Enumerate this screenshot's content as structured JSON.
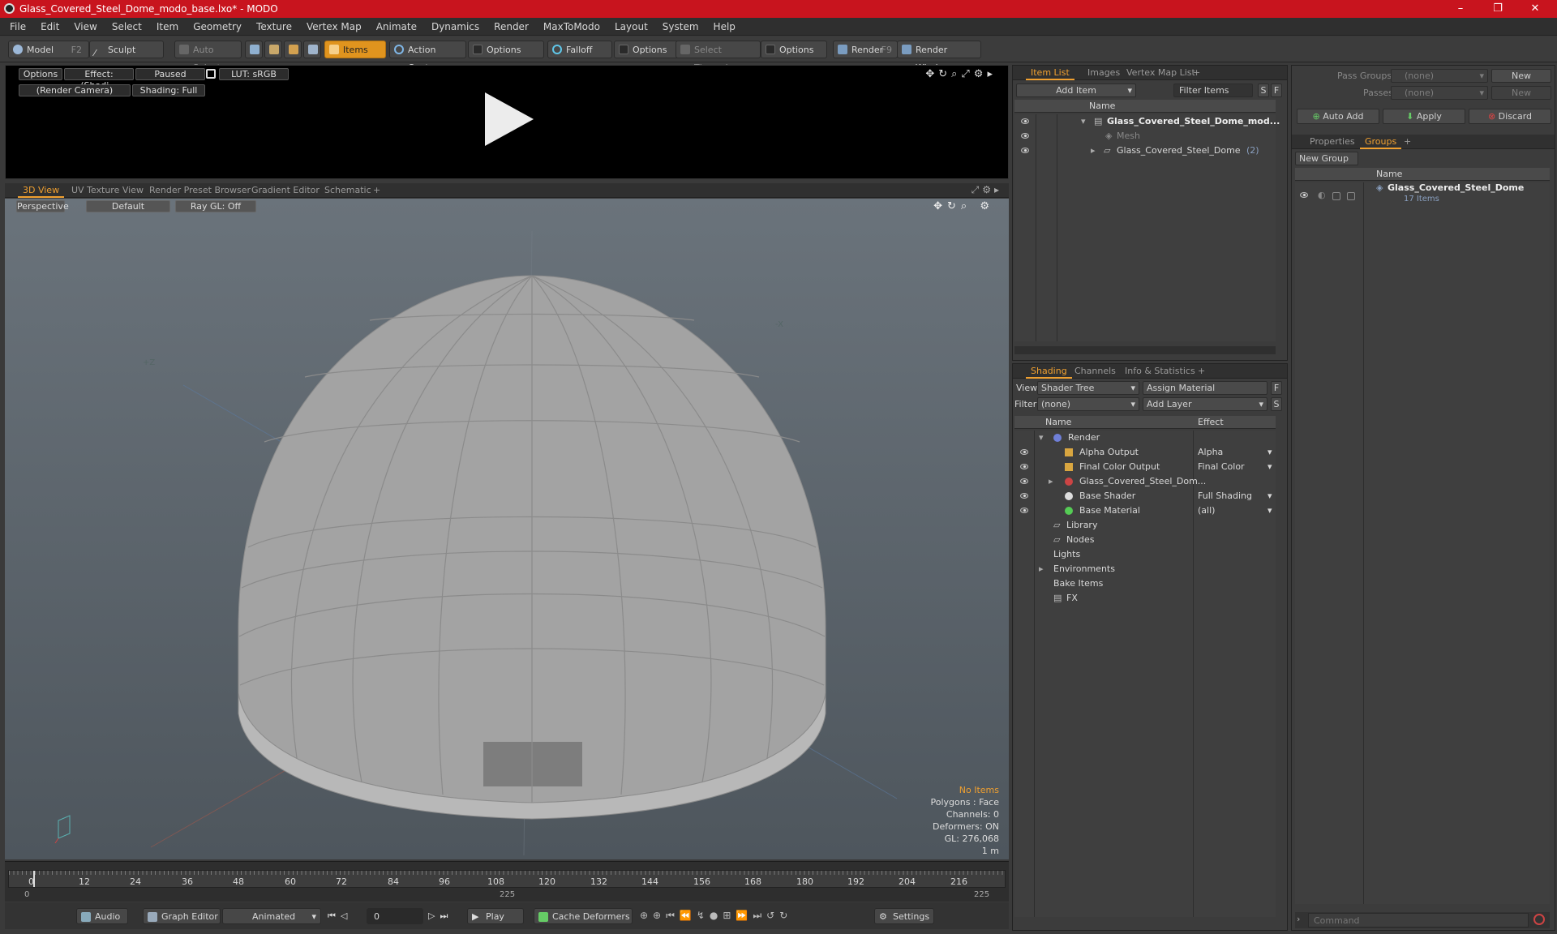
{
  "window": {
    "title": "Glass_Covered_Steel_Dome_modo_base.lxo* - MODO",
    "minimize": "–",
    "restore": "❐",
    "close": "✕"
  },
  "menu": [
    "File",
    "Edit",
    "View",
    "Select",
    "Item",
    "Geometry",
    "Texture",
    "Vertex Map",
    "Animate",
    "Dynamics",
    "Render",
    "MaxToModo",
    "Layout",
    "System",
    "Help"
  ],
  "toolbar": {
    "model": "Model",
    "model_key": "F2",
    "sculpt": "Sculpt",
    "auto_select": "Auto Select",
    "items": "Items",
    "action_center": "Action Center",
    "options1": "Options",
    "falloff": "Falloff",
    "options2": "Options",
    "select_through": "Select Through",
    "options3": "Options",
    "render": "Render",
    "render_key": "F9",
    "render_window": "Render Window"
  },
  "preview": {
    "options": "Options",
    "effect": "Effect: (Shadi...",
    "paused": "Paused",
    "lut": "LUT: sRGB",
    "camera": "(Render Camera)",
    "shading": "Shading: Full"
  },
  "viewport_tabs": [
    "3D View",
    "UV Texture View",
    "Render Preset Browser",
    "Gradient Editor",
    "Schematic",
    "+"
  ],
  "viewport": {
    "perspective": "Perspective",
    "default": "Default",
    "raygl": "Ray GL: Off",
    "axis_z": "+Z",
    "axis_x": "-X",
    "info": {
      "no_items": "No Items",
      "polygons": "Polygons : Face",
      "channels": "Channels: 0",
      "deformers": "Deformers: ON",
      "gl": "GL: 276,068",
      "unit": "1 m"
    }
  },
  "timeline": {
    "ticks": [
      "0",
      "12",
      "24",
      "36",
      "48",
      "60",
      "72",
      "84",
      "96",
      "108",
      "120",
      "132",
      "144",
      "156",
      "168",
      "180",
      "192",
      "204",
      "216"
    ],
    "start": "0",
    "mid": "225",
    "end": "225"
  },
  "bottom": {
    "audio": "Audio",
    "graph_editor": "Graph Editor",
    "animated": "Animated",
    "frame": "0",
    "play": "Play",
    "cache": "Cache Deformers",
    "settings": "Settings"
  },
  "item_list": {
    "tabs": [
      "Item List",
      "Images",
      "Vertex Map List",
      "+"
    ],
    "add_item": "Add Item",
    "filter": "Filter Items",
    "s": "S",
    "f": "F",
    "col_name": "Name",
    "rows": [
      {
        "label": "Glass_Covered_Steel_Dome_mod...",
        "count": ""
      },
      {
        "label": "Mesh",
        "count": ""
      },
      {
        "label": "Glass_Covered_Steel_Dome",
        "count": "(2)"
      }
    ]
  },
  "shading": {
    "tabs": [
      "Shading",
      "Channels",
      "Info & Statistics",
      "+"
    ],
    "view_label": "View",
    "view_value": "Shader Tree",
    "assign": "Assign Material",
    "f": "F",
    "filter_label": "Filter",
    "filter_value": "(none)",
    "add_layer": "Add Layer",
    "s": "S",
    "col_name": "Name",
    "col_effect": "Effect",
    "rows": [
      {
        "name": "Render",
        "effect": ""
      },
      {
        "name": "Alpha Output",
        "effect": "Alpha"
      },
      {
        "name": "Final Color Output",
        "effect": "Final Color"
      },
      {
        "name": "Glass_Covered_Steel_Dom...",
        "effect": ""
      },
      {
        "name": "Base Shader",
        "effect": "Full Shading"
      },
      {
        "name": "Base Material",
        "effect": "(all)"
      },
      {
        "name": "Library",
        "effect": ""
      },
      {
        "name": "Nodes",
        "effect": ""
      },
      {
        "name": "Lights",
        "effect": ""
      },
      {
        "name": "Environments",
        "effect": ""
      },
      {
        "name": "Bake Items",
        "effect": ""
      },
      {
        "name": "FX",
        "effect": ""
      }
    ]
  },
  "groups_panel": {
    "pass_groups_label": "Pass Groups",
    "pass_groups_value": "(none)",
    "new": "New",
    "passes_label": "Passes",
    "passes_value": "(none)",
    "new2": "New",
    "auto_add": "Auto Add",
    "apply": "Apply",
    "discard": "Discard",
    "tabs": [
      "Properties",
      "Groups",
      "+"
    ],
    "new_group": "New Group",
    "col_name": "Name",
    "group_name": "Glass_Covered_Steel_Dome",
    "group_count": "17 Items",
    "command_placeholder": "Command"
  }
}
